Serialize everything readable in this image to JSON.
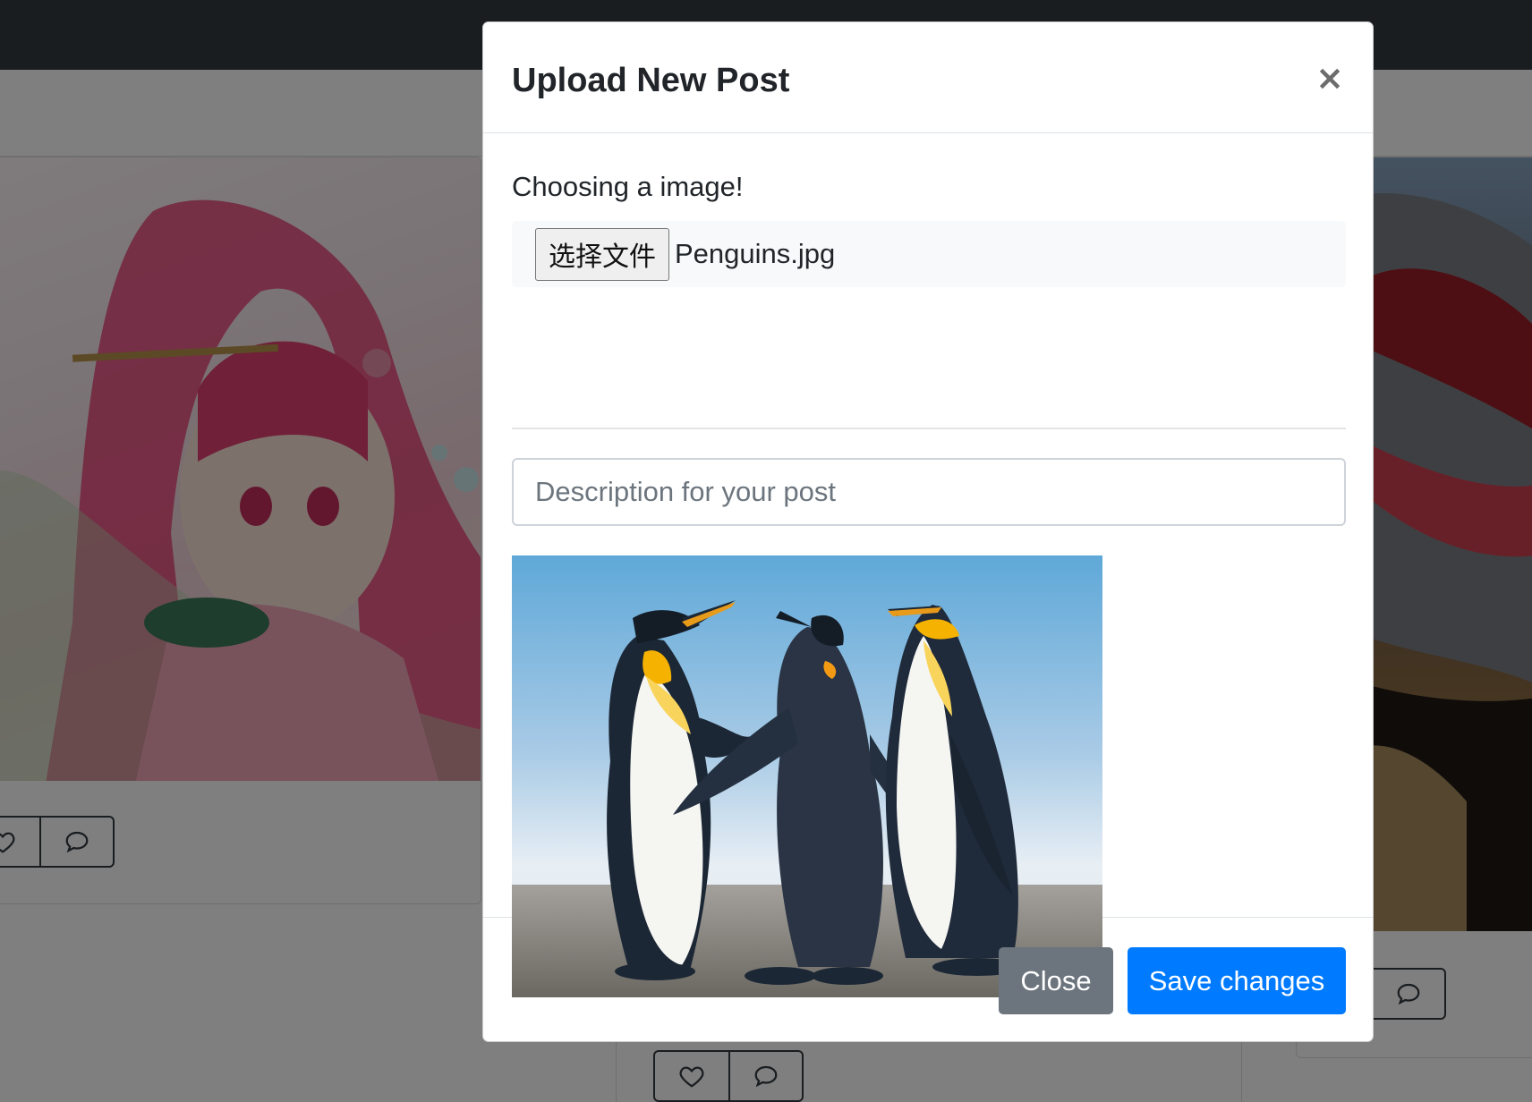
{
  "modal": {
    "title": "Upload New Post",
    "close_symbol": "×",
    "choose_label": "Choosing a image!",
    "file_button_label": "选择文件",
    "file_name": "Penguins.jpg",
    "description_placeholder": "Description for your post",
    "description_value": "",
    "preview_image": "penguins-preview",
    "buttons": {
      "close_label": "Close",
      "save_label": "Save changes"
    }
  },
  "background": {
    "cards": [
      {
        "image": "anime-girl-illustration",
        "actions": [
          "heart-icon",
          "comment-icon"
        ]
      },
      {
        "image": "wolf-mask-photo",
        "actions": [
          "heart-icon",
          "comment-icon"
        ]
      },
      {
        "image": "",
        "actions": [
          "heart-icon",
          "comment-icon"
        ]
      }
    ]
  },
  "colors": {
    "navbar": "#343a40",
    "primary": "#007bff",
    "secondary": "#6c757d",
    "overlay": "rgba(0,0,0,0.5)"
  }
}
